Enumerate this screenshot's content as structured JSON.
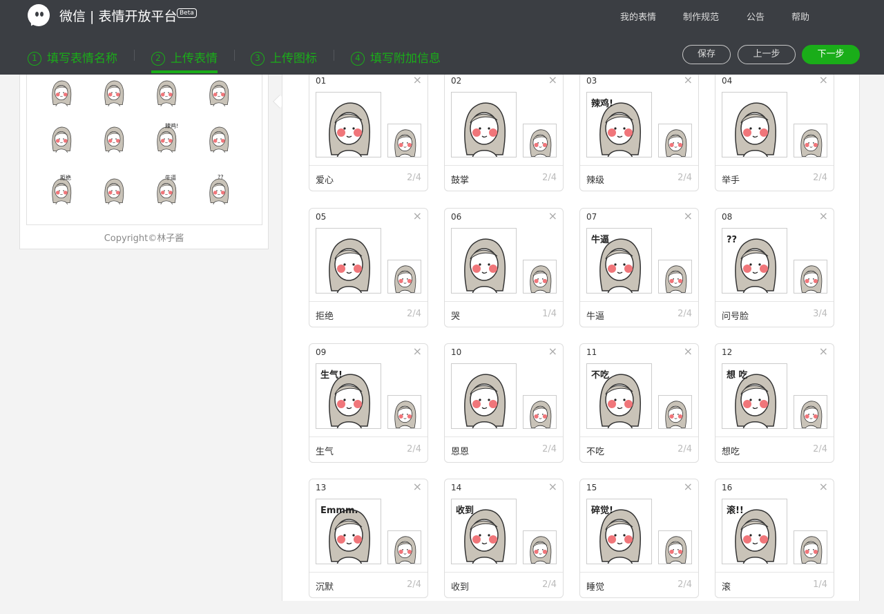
{
  "header": {
    "app_title": "微信 | 表情开放平台",
    "beta": "Beta",
    "nav": [
      "我的表情",
      "制作规范",
      "公告",
      "帮助"
    ]
  },
  "steps": [
    {
      "num": "1",
      "label": "填写表情名称",
      "active": false
    },
    {
      "num": "2",
      "label": "上传表情",
      "active": true
    },
    {
      "num": "3",
      "label": "上传图标",
      "active": false
    },
    {
      "num": "4",
      "label": "填写附加信息",
      "active": false
    }
  ],
  "actions": {
    "save": "保存",
    "prev": "上一步",
    "next": "下一步"
  },
  "preview": {
    "copyright": "Copyright©林子酱",
    "captions": [
      "辣鸡!",
      "拒绝",
      "牛逼",
      "??"
    ]
  },
  "stickers": [
    {
      "no": "01",
      "name": "爱心",
      "page": "2/4",
      "tag": ""
    },
    {
      "no": "02",
      "name": "鼓掌",
      "page": "2/4",
      "tag": ""
    },
    {
      "no": "03",
      "name": "辣级",
      "page": "2/4",
      "tag": "辣鸡!"
    },
    {
      "no": "04",
      "name": "举手",
      "page": "2/4",
      "tag": ""
    },
    {
      "no": "05",
      "name": "拒绝",
      "page": "2/4",
      "tag": ""
    },
    {
      "no": "06",
      "name": "哭",
      "page": "1/4",
      "tag": ""
    },
    {
      "no": "07",
      "name": "牛逼",
      "page": "2/4",
      "tag": "牛逼"
    },
    {
      "no": "08",
      "name": "问号脸",
      "page": "3/4",
      "tag": "??"
    },
    {
      "no": "09",
      "name": "生气",
      "page": "2/4",
      "tag": "生气!"
    },
    {
      "no": "10",
      "name": "恩恩",
      "page": "2/4",
      "tag": ""
    },
    {
      "no": "11",
      "name": "不吃",
      "page": "2/4",
      "tag": "不吃"
    },
    {
      "no": "12",
      "name": "想吃",
      "page": "2/4",
      "tag": "想 吃"
    },
    {
      "no": "13",
      "name": "沉默",
      "page": "2/4",
      "tag": "Emmm."
    },
    {
      "no": "14",
      "name": "收到",
      "page": "2/4",
      "tag": "收到"
    },
    {
      "no": "15",
      "name": "睡觉",
      "page": "2/4",
      "tag": "碎觉!"
    },
    {
      "no": "16",
      "name": "滚",
      "page": "1/4",
      "tag": "滚!!"
    }
  ],
  "icons": {
    "close": "close-icon",
    "logo": "wechat-logo-icon",
    "step_number": "circled-number-icon"
  },
  "colors": {
    "header_bg": "#3b3e43",
    "accent": "#1aad19",
    "cheek": "#f0767a"
  }
}
